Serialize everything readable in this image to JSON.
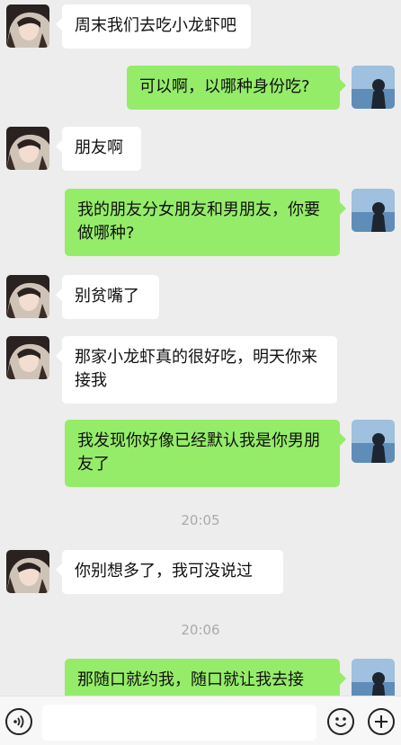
{
  "messages": [
    {
      "side": "left",
      "text": "周末我们去吃小龙虾吧"
    },
    {
      "side": "right",
      "text": "可以啊，以哪种身份吃?"
    },
    {
      "side": "left",
      "text": "朋友啊"
    },
    {
      "side": "right",
      "text": "我的朋友分女朋友和男朋友，你要做哪种?"
    },
    {
      "side": "left",
      "text": "别贫嘴了"
    },
    {
      "side": "left",
      "text": "那家小龙虾真的很好吃，明天你来接我"
    },
    {
      "side": "right",
      "text": "我发现你好像已经默认我是你男朋友了"
    },
    {
      "time": "20:05"
    },
    {
      "side": "left",
      "text": "你别想多了，我可没说过"
    },
    {
      "time": "20:06"
    },
    {
      "side": "right",
      "text": "那随口就约我，随口就让我去接"
    }
  ],
  "input": {
    "value": "",
    "placeholder": ""
  },
  "icons": {
    "voice": "voice-icon",
    "emoji": "emoji-icon",
    "plus": "plus-icon"
  },
  "colors": {
    "background": "#ededed",
    "self_bubble": "#95ec69",
    "other_bubble": "#ffffff",
    "timestamp": "#aaaaaa"
  }
}
